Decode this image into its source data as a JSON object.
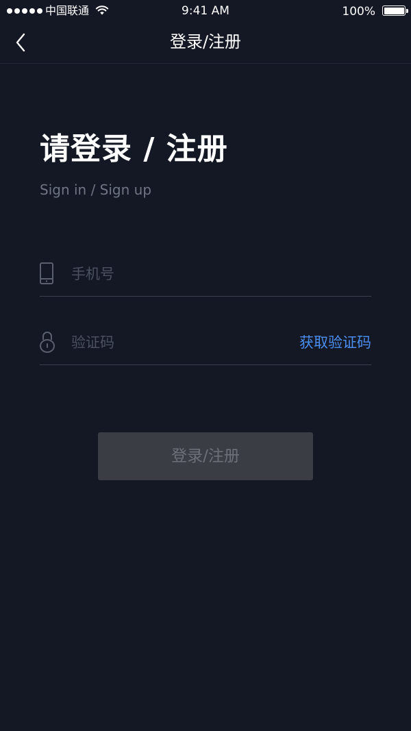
{
  "status_bar": {
    "carrier": "中国联通",
    "time": "9:41 AM",
    "battery": "100%"
  },
  "nav": {
    "title": "登录/注册",
    "back_icon": "chevron-left-icon"
  },
  "heading": {
    "title": "请登录 / 注册",
    "subtitle": "Sign in / Sign up"
  },
  "form": {
    "phone": {
      "icon": "phone-icon",
      "placeholder": "手机号",
      "value": ""
    },
    "code": {
      "icon": "lock-icon",
      "placeholder": "验证码",
      "value": "",
      "get_code_label": "获取验证码"
    },
    "submit_label": "登录/注册"
  },
  "colors": {
    "background": "#141824",
    "accent": "#4a8ef2",
    "button_disabled": "#3a3d44"
  }
}
